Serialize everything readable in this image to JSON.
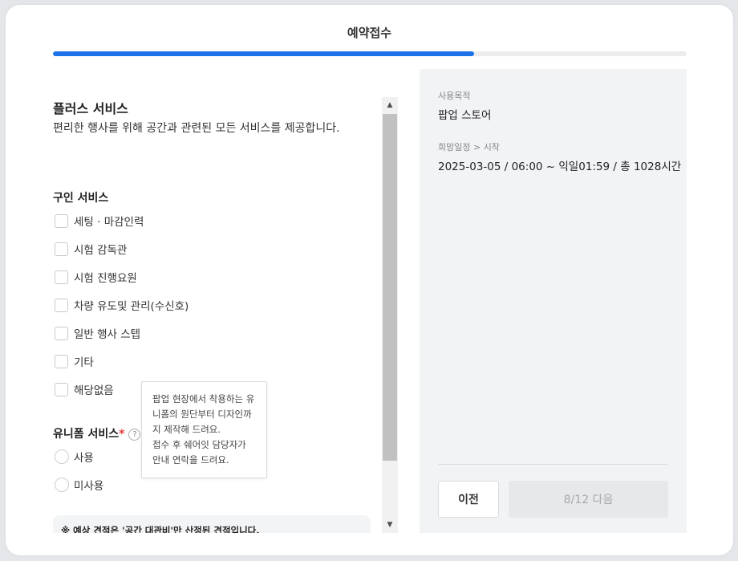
{
  "header": {
    "title": "예약접수",
    "progress_percent": 66.5
  },
  "plus": {
    "heading": "플러스 서비스",
    "description": "편리한 행사를 위해 공간과 관련된 모든 서비스를 제공합니다."
  },
  "hiring": {
    "heading": "구인 서비스",
    "options": [
      "세팅 · 마감인력",
      "시험 감독관",
      "시험 진행요원",
      "차량 유도및 관리(수신호)",
      "일반 행사 스텝",
      "기타",
      "해당없음"
    ]
  },
  "uniform": {
    "heading": "유니폼 서비스",
    "required_mark": "*",
    "help_glyph": "?",
    "options": [
      "사용",
      "미사용"
    ],
    "tooltip": [
      "팝업 현장에서 착용하는 유",
      "니폼의 원단부터 디자인까",
      "지 제작해 드려요.",
      "접수 후 쉐어잇 담당자가",
      "안내 연락을 드려요."
    ]
  },
  "note": {
    "text": "※ 예상 견적은 '공간 대관비'만 산정된 견적입니다."
  },
  "summary": {
    "purpose_label": "사용목적",
    "purpose_value": "팝업 스토어",
    "schedule_label": "희망일정 > 시작",
    "schedule_value": "2025-03-05 / 06:00 ~ 익일01:59 / 총 1028시간"
  },
  "footer": {
    "prev_label": "이전",
    "next_label": "8/12 다음"
  },
  "colors": {
    "accent": "#1a73e8",
    "required": "#e53935"
  }
}
